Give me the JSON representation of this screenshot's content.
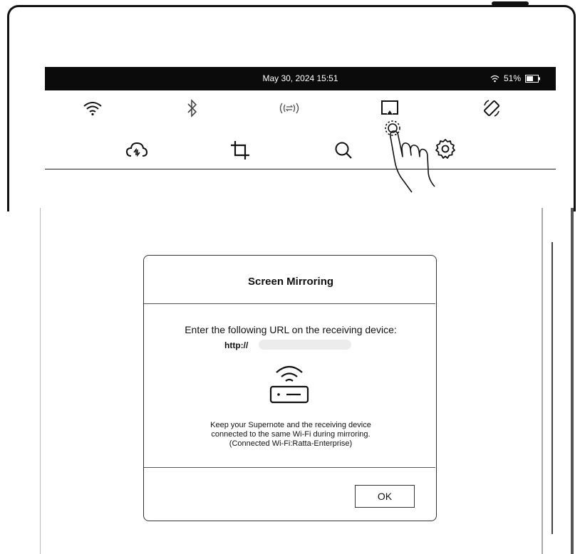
{
  "status_bar": {
    "datetime": "May 30, 2024  15:51",
    "battery": "51%"
  },
  "quick_settings": {
    "row1": [
      "wifi-icon",
      "bluetooth-icon",
      "wifi-transfer-icon",
      "screen-mirroring-icon",
      "rotate-icon"
    ],
    "row2": [
      "cloud-sync-icon",
      "crop-icon",
      "search-icon",
      "settings-icon"
    ]
  },
  "dialog": {
    "title": "Screen Mirroring",
    "instruction": "Enter the following URL on the receiving device:",
    "url_prefix": "http://",
    "note_line1": "Keep your Supernote and the receiving device",
    "note_line2": "connected to the same Wi-Fi during mirroring.",
    "note_line3": "(Connected Wi-Fi:Ratta-Enterprise)",
    "ok_label": "OK"
  }
}
